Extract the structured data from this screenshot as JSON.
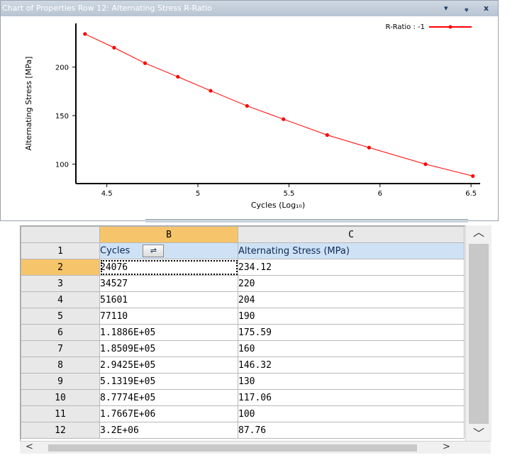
{
  "window": {
    "title": "Chart of Properties Row 12: Alternating Stress R-Ratio",
    "buttons": {
      "dropdown": "▾",
      "pin": "ᵩ",
      "close": "x"
    }
  },
  "chart_data": {
    "type": "line",
    "x": [
      4.38,
      4.54,
      4.71,
      4.89,
      5.07,
      5.27,
      5.47,
      5.71,
      5.94,
      6.25,
      6.51
    ],
    "series": [
      {
        "name": "R-Ratio : -1",
        "values": [
          234.12,
          220,
          204,
          190,
          175.59,
          160,
          146.32,
          130,
          117.06,
          100,
          87.76
        ],
        "color": "#ff0000"
      }
    ],
    "xlabel": "Cycles (Log₁₀)",
    "ylabel": "Alternating Stress [MPa]",
    "xlim": [
      4.33,
      6.55
    ],
    "ylim": [
      80,
      245
    ],
    "xticks": [
      "4.5",
      "5",
      "5.5",
      "6",
      "6.5"
    ],
    "yticks": [
      "100",
      "150",
      "200"
    ],
    "grid": false,
    "legend": "top-right"
  },
  "grid": {
    "columns": [
      "B",
      "C"
    ],
    "row1": {
      "num": "1",
      "B": "Cycles",
      "C": "Alternating Stress (MPa)"
    },
    "rows": [
      {
        "num": "2",
        "B": "24076",
        "C": "234.12"
      },
      {
        "num": "3",
        "B": "34527",
        "C": "220"
      },
      {
        "num": "4",
        "B": "51601",
        "C": "204"
      },
      {
        "num": "5",
        "B": "77110",
        "C": "190"
      },
      {
        "num": "6",
        "B": "1.1886E+05",
        "C": "175.59"
      },
      {
        "num": "7",
        "B": "1.8509E+05",
        "C": "160"
      },
      {
        "num": "8",
        "B": "2.9425E+05",
        "C": "146.32"
      },
      {
        "num": "9",
        "B": "5.1319E+05",
        "C": "130"
      },
      {
        "num": "10",
        "B": "8.7774E+05",
        "C": "117.06"
      },
      {
        "num": "11",
        "B": "1.7667E+06",
        "C": "100"
      },
      {
        "num": "12",
        "B": "3.2E+06",
        "C": "87.76"
      }
    ],
    "scroll": {
      "up": "︿",
      "down": "﹀",
      "left": "<",
      "right": ">"
    }
  }
}
